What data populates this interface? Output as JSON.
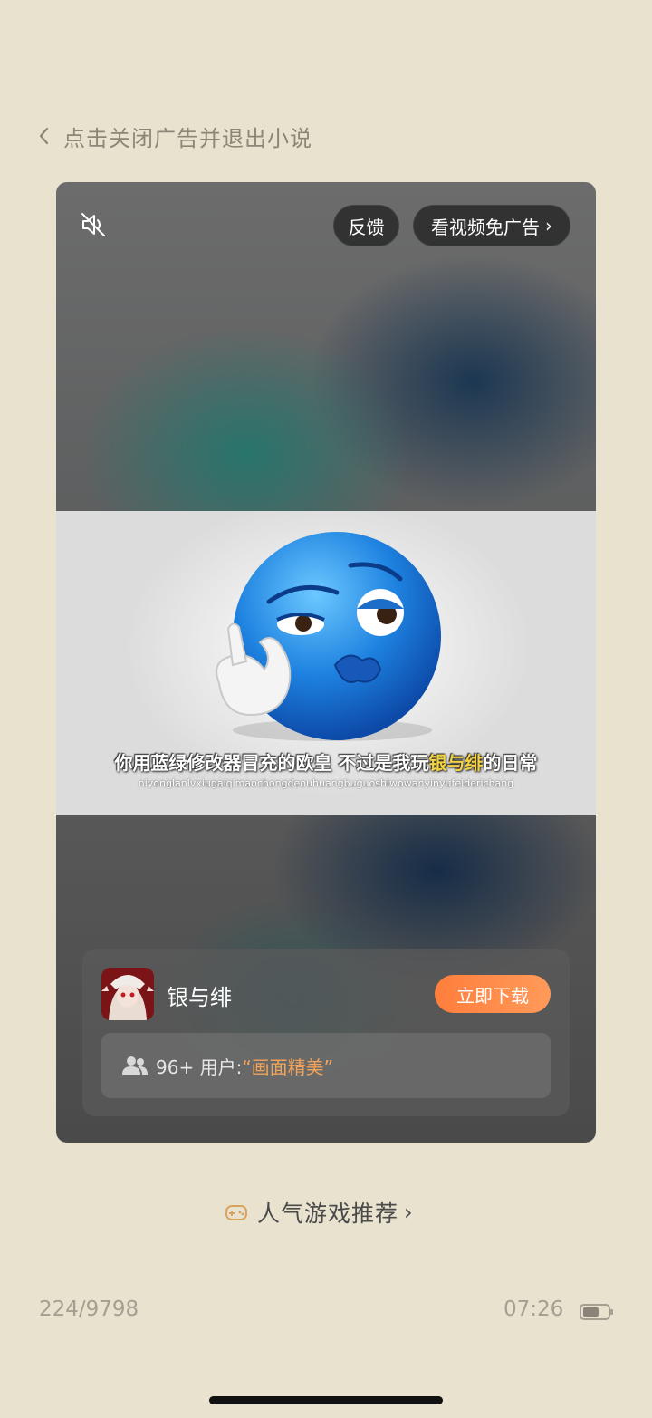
{
  "header": {
    "back_label": "点击关闭广告并退出小说"
  },
  "ad": {
    "feedback_label": "反馈",
    "skip_label": "看视频免广告",
    "skip_chevron": "›",
    "video": {
      "subtitle_before": "你用蓝绿修改器冒充的欧皇 不过是我玩",
      "subtitle_highlight": "银与绯",
      "subtitle_after": "的日常",
      "pinyin": "niyonglanlvxiugaiqimaochongdeouhuangbuguoshiwowanyinyufeiderichang"
    },
    "app": {
      "name": "银与绯",
      "download_label": "立即下载",
      "review_count": "96+ 用户:",
      "review_quote": "“画面精美”"
    }
  },
  "recommend": {
    "label": "人气游戏推荐",
    "chevron": "›"
  },
  "footer": {
    "page_progress": "224/9798",
    "time": "07:26",
    "battery_level": 0.65
  },
  "colors": {
    "background": "#e8e2cf",
    "accent": "#ff8a48",
    "highlight": "#f3d343",
    "quote": "#f0a35c"
  },
  "icons": [
    "back-chevron-icon",
    "mute-icon",
    "users-icon",
    "gamepad-icon",
    "battery-icon"
  ]
}
